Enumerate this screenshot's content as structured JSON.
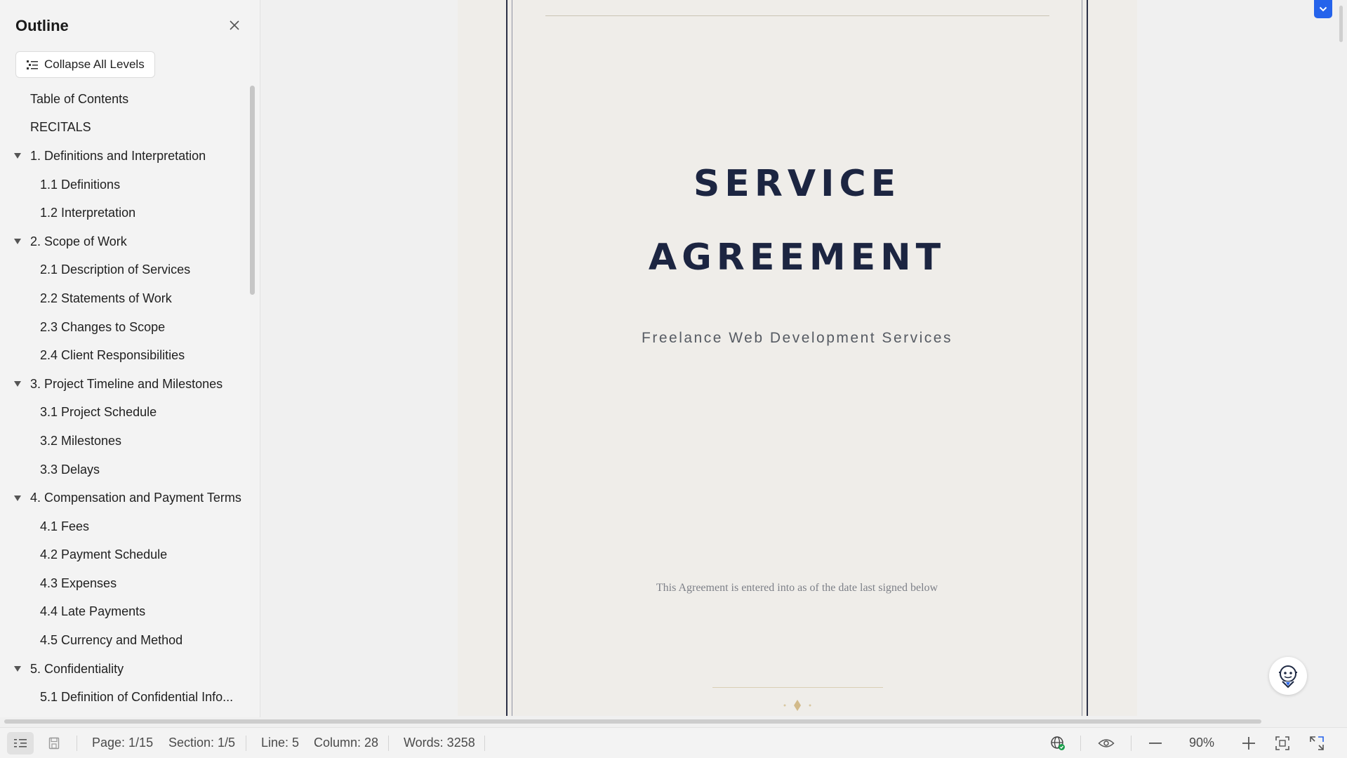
{
  "outline": {
    "title": "Outline",
    "collapse_label": "Collapse All Levels",
    "items": [
      {
        "label": "Table of Contents",
        "level": 1,
        "expandable": false
      },
      {
        "label": "RECITALS",
        "level": 1,
        "expandable": false
      },
      {
        "label": "1. Definitions and Interpretation",
        "level": 1,
        "expandable": true
      },
      {
        "label": "1.1 Definitions",
        "level": 2,
        "expandable": false
      },
      {
        "label": "1.2 Interpretation",
        "level": 2,
        "expandable": false
      },
      {
        "label": "2. Scope of Work",
        "level": 1,
        "expandable": true
      },
      {
        "label": "2.1 Description of Services",
        "level": 2,
        "expandable": false
      },
      {
        "label": "2.2 Statements of Work",
        "level": 2,
        "expandable": false
      },
      {
        "label": "2.3 Changes to Scope",
        "level": 2,
        "expandable": false
      },
      {
        "label": "2.4 Client Responsibilities",
        "level": 2,
        "expandable": false
      },
      {
        "label": "3. Project Timeline and Milestones",
        "level": 1,
        "expandable": true
      },
      {
        "label": "3.1 Project Schedule",
        "level": 2,
        "expandable": false
      },
      {
        "label": "3.2 Milestones",
        "level": 2,
        "expandable": false
      },
      {
        "label": "3.3 Delays",
        "level": 2,
        "expandable": false
      },
      {
        "label": "4. Compensation and Payment Terms",
        "level": 1,
        "expandable": true
      },
      {
        "label": "4.1 Fees",
        "level": 2,
        "expandable": false
      },
      {
        "label": "4.2 Payment Schedule",
        "level": 2,
        "expandable": false
      },
      {
        "label": "4.3 Expenses",
        "level": 2,
        "expandable": false
      },
      {
        "label": "4.4 Late Payments",
        "level": 2,
        "expandable": false
      },
      {
        "label": "4.5 Currency and Method",
        "level": 2,
        "expandable": false
      },
      {
        "label": "5. Confidentiality",
        "level": 1,
        "expandable": true
      },
      {
        "label": "5.1 Definition of Confidential Info...",
        "level": 2,
        "expandable": false
      }
    ]
  },
  "document": {
    "title_line_1": "SERVICE",
    "title_line_2": "AGREEMENT",
    "subtitle": "Freelance Web Development Services",
    "note": "This Agreement is entered into as of the date last signed below"
  },
  "status": {
    "page": "Page: 1/15",
    "section": "Section: 1/5",
    "line": "Line: 5",
    "column": "Column: 28",
    "words": "Words: 3258",
    "zoom": "90%"
  },
  "colors": {
    "accent": "#2563eb",
    "title": "#1c2541",
    "page_background": "#efede9"
  },
  "icons": [
    "close-icon",
    "collapse-levels-icon",
    "chevron-down-icon",
    "assistant-robot-icon",
    "outline-toggle-icon",
    "save-icon",
    "globe-check-icon",
    "eye-icon",
    "minus-icon",
    "plus-icon",
    "fit-page-icon",
    "fullscreen-icon"
  ]
}
